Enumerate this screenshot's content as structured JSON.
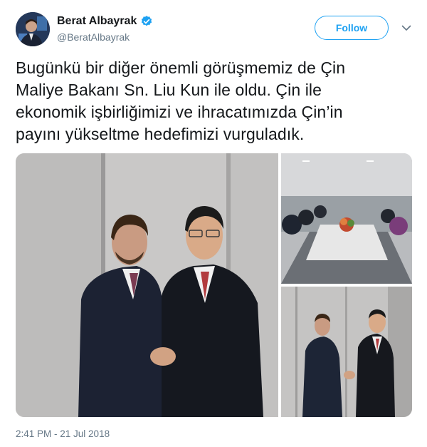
{
  "user": {
    "display_name": "Berat Albayrak",
    "handle": "@BeratAlbayrak",
    "verified": true
  },
  "actions": {
    "follow_label": "Follow",
    "menu_icon": "chevron-down-icon"
  },
  "tweet": {
    "lines": [
      "Bugünkü bir diğer önemli görüşmemiz de Çin",
      "Maliye Bakanı Sn. Liu Kun ile oldu. Çin ile",
      "ekonomik işbirliğimizi ve ihracatımızda Çin’in",
      "payını yükseltme hedefimizi vurguladık."
    ],
    "timestamp": "2:41 PM - 21 Jul 2018"
  },
  "colors": {
    "accent": "#1da1f2",
    "text": "#14171a",
    "secondary": "#657786"
  }
}
